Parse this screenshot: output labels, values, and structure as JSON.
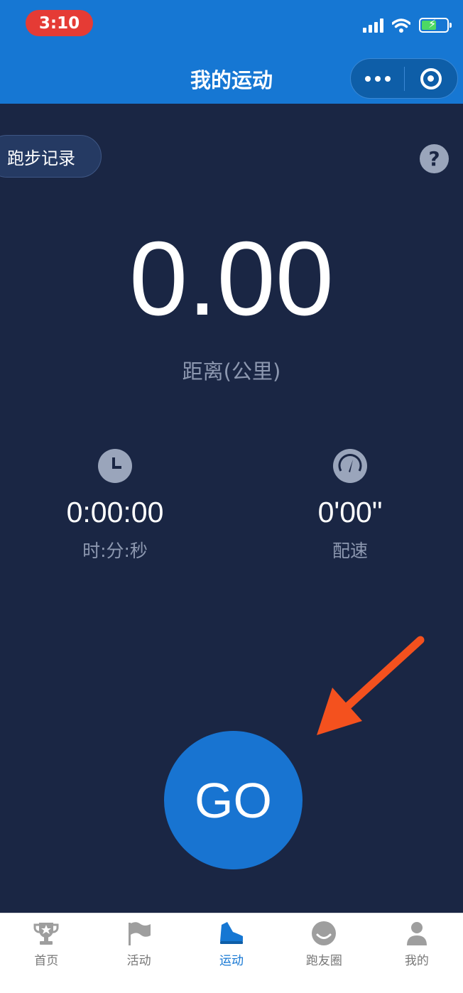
{
  "status_bar": {
    "time": "3:10"
  },
  "nav": {
    "title": "我的运动"
  },
  "records_button": "跑步记录",
  "help_button": "?",
  "distance": {
    "value": "0.00",
    "label": "距离(公里)"
  },
  "stats": {
    "time": {
      "value": "0:00:00",
      "label": "时:分:秒"
    },
    "pace": {
      "value": "0'00\"",
      "label": "配速"
    }
  },
  "go_button": "GO",
  "tabs": [
    {
      "label": "首页",
      "icon": "trophy-icon"
    },
    {
      "label": "活动",
      "icon": "flag-icon"
    },
    {
      "label": "运动",
      "icon": "shoe-icon",
      "active": true
    },
    {
      "label": "跑友圈",
      "icon": "smile-icon"
    },
    {
      "label": "我的",
      "icon": "user-icon"
    }
  ],
  "colors": {
    "primary": "#1677d3",
    "background": "#1a2644",
    "accent_arrow": "#f4511e"
  }
}
